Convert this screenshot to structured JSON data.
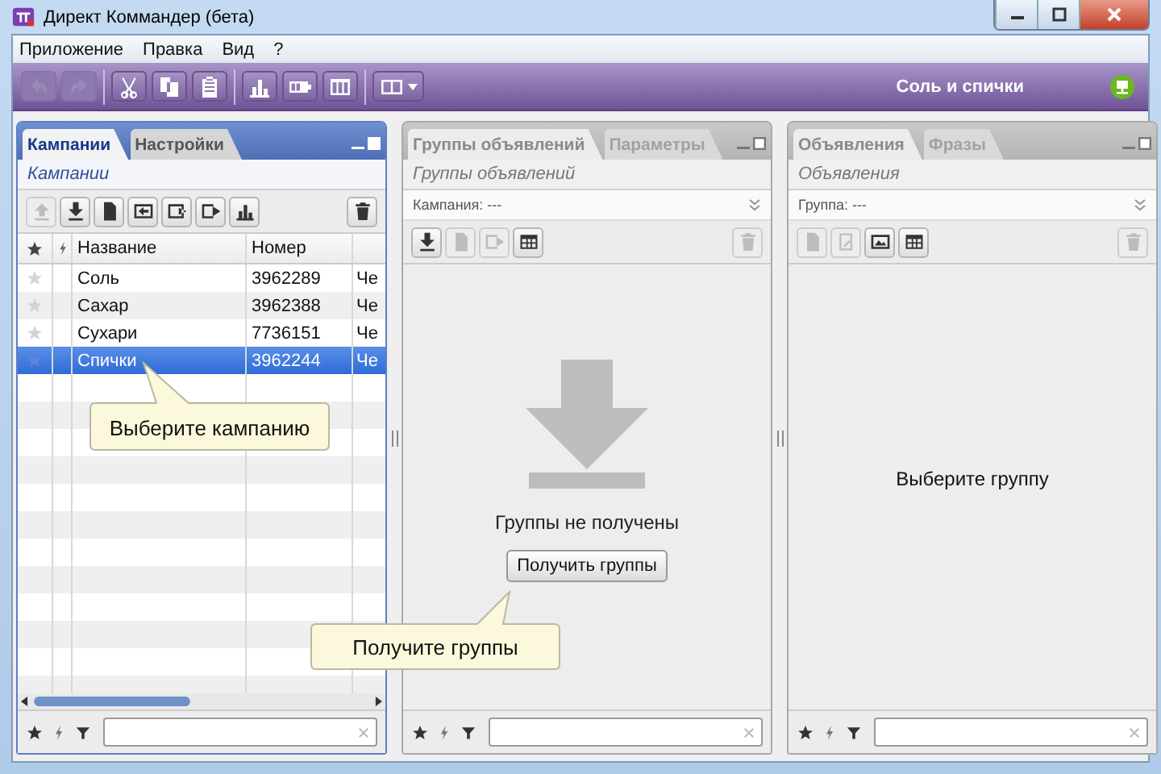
{
  "window": {
    "title": "Директ Коммандер (бета)"
  },
  "menu": [
    "Приложение",
    "Правка",
    "Вид",
    "?"
  ],
  "toolbar": {
    "buttons": [
      {
        "kind": "undo",
        "disabled": true
      },
      {
        "kind": "redo",
        "disabled": true
      },
      {
        "kind": "separator"
      },
      {
        "kind": "cut",
        "disabled": false
      },
      {
        "kind": "copy",
        "disabled": false
      },
      {
        "kind": "paste",
        "disabled": false
      },
      {
        "kind": "separator"
      },
      {
        "kind": "chart",
        "disabled": false
      },
      {
        "kind": "battery",
        "disabled": false
      },
      {
        "kind": "columns",
        "disabled": false
      },
      {
        "kind": "separator"
      },
      {
        "kind": "layout",
        "disabled": false
      }
    ],
    "account": "Соль и спички",
    "online": true
  },
  "panels": [
    {
      "kind": "table",
      "active": true,
      "tabs": [
        {
          "label": "Кампании",
          "selected": true
        },
        {
          "label": "Настройки",
          "selected": false
        }
      ],
      "subtitle": "Кампании",
      "tools": [
        {
          "kind": "up",
          "disabled": true
        },
        {
          "kind": "download",
          "disabled": false
        },
        {
          "kind": "document",
          "disabled": false
        },
        {
          "kind": "import",
          "disabled": false
        },
        {
          "kind": "frame-in",
          "disabled": false
        },
        {
          "kind": "export",
          "disabled": false
        },
        {
          "kind": "chart",
          "disabled": false
        }
      ],
      "table": {
        "columns": [
          "Название",
          "Номер"
        ],
        "rows": [
          {
            "name": "Соль",
            "number": "3962289",
            "column_3": "Че",
            "selected": false
          },
          {
            "name": "Сахар",
            "number": "3962388",
            "column_3": "Че",
            "selected": false
          },
          {
            "name": "Сухари",
            "number": "7736151",
            "column_3": "Че",
            "selected": false
          },
          {
            "name": "Спички",
            "number": "3962244",
            "column_3": "Че",
            "selected": true
          }
        ]
      },
      "hint": "Выберите кампанию"
    },
    {
      "kind": "empty",
      "active": false,
      "tabs": [
        {
          "label": "Группы объявлений",
          "selected": true
        },
        {
          "label": "Параметры",
          "selected": false
        }
      ],
      "subtitle": "Группы объявлений",
      "filter": "Кампания: ---",
      "tools": [
        {
          "kind": "download",
          "disabled": false
        },
        {
          "kind": "document",
          "disabled": true
        },
        {
          "kind": "export",
          "disabled": true
        },
        {
          "kind": "table",
          "disabled": false
        }
      ],
      "message": "Группы не получены",
      "action": "Получить группы",
      "hint": "Получите группы"
    },
    {
      "kind": "placeholder",
      "active": false,
      "tabs": [
        {
          "label": "Объявления",
          "selected": true
        },
        {
          "label": "Фразы",
          "selected": false
        }
      ],
      "subtitle": "Объявления",
      "filter": "Группа: ---",
      "tools": [
        {
          "kind": "document",
          "disabled": true
        },
        {
          "kind": "edit",
          "disabled": true
        },
        {
          "kind": "image",
          "disabled": false
        },
        {
          "kind": "table",
          "disabled": false
        }
      ],
      "message": "Выберите группу"
    }
  ]
}
